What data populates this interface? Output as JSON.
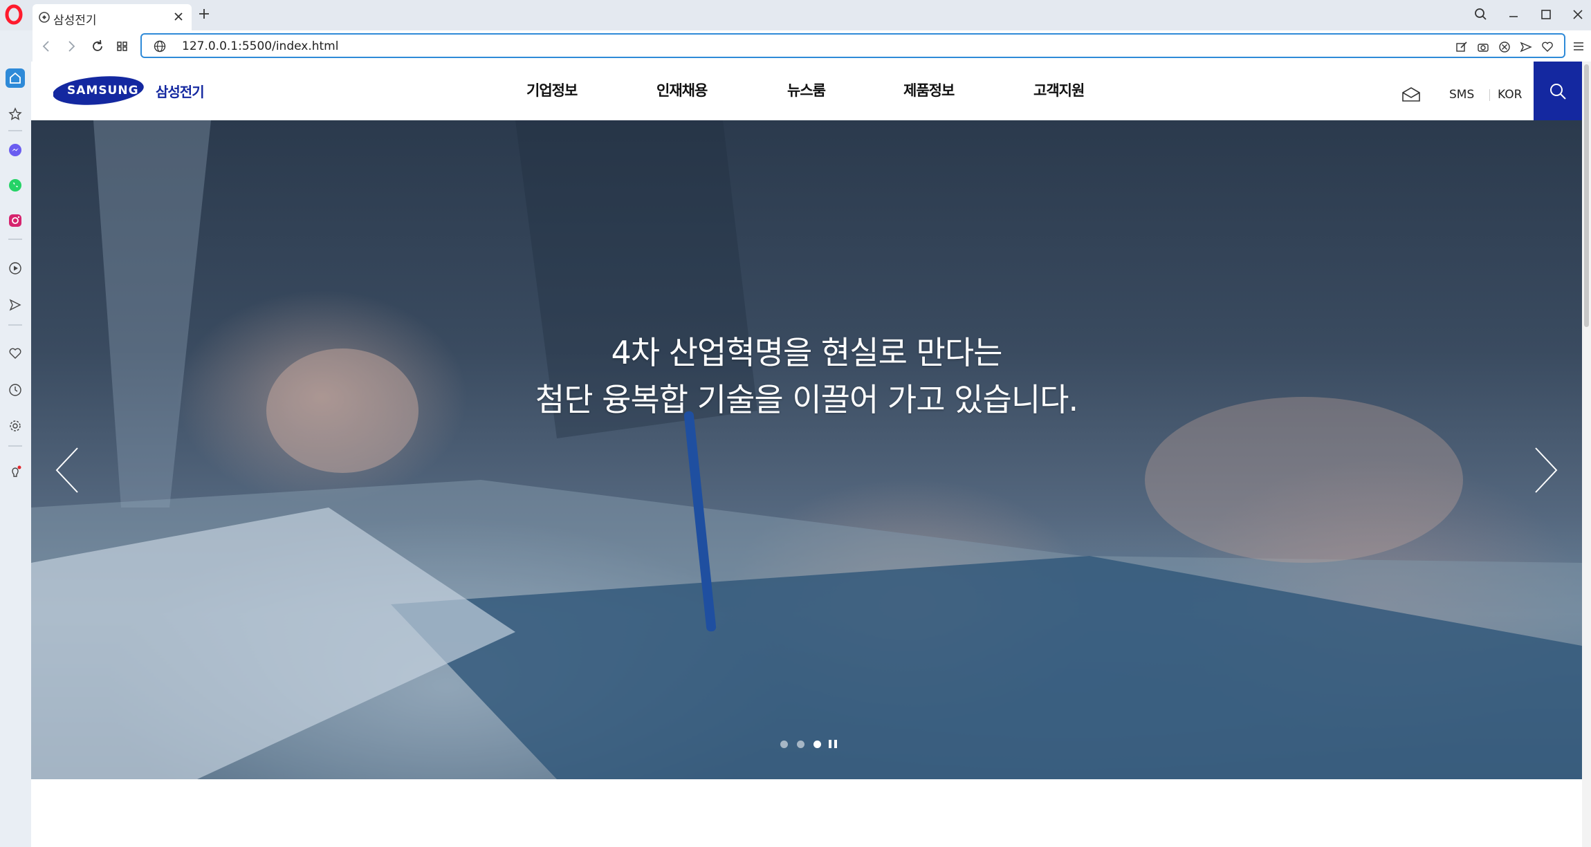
{
  "browser": {
    "tab_title": "삼성전기",
    "url": "127.0.0.1:5500/index.html"
  },
  "site": {
    "logo_wordmark": "SAMSUNG",
    "logo_text": "삼성전기",
    "nav": [
      "기업정보",
      "인재채용",
      "뉴스룸",
      "제품정보",
      "고객지원"
    ],
    "util": {
      "sms": "SMS",
      "lang": "KOR"
    },
    "brand_color": "#1428a0"
  },
  "hero": {
    "line1": "4차 산업혁명을 현실로 만다는",
    "line2": "첨단 융복합 기술을 이끌어 가고 있습니다.",
    "slide_count": 3,
    "active_slide": 3
  },
  "icons": {
    "sidebar": [
      "home-icon",
      "star-icon",
      "messenger-icon",
      "whatsapp-icon",
      "instagram-icon",
      "player-icon",
      "send-icon",
      "heart-icon",
      "history-icon",
      "settings-icon",
      "tips-icon"
    ]
  }
}
